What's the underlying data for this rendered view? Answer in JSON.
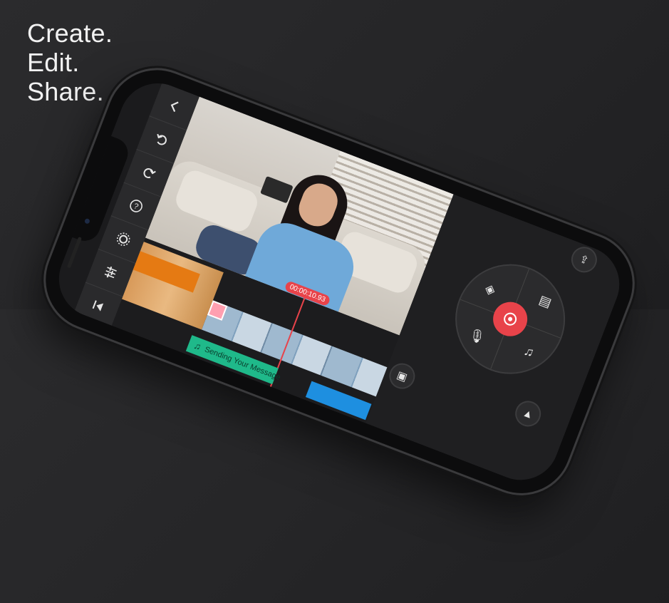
{
  "tagline": [
    "Create.",
    "Edit.",
    "Share."
  ],
  "toolbar": {
    "items": [
      {
        "name": "back-button",
        "icon": "chevron-left-icon"
      },
      {
        "name": "undo-button",
        "icon": "undo-icon"
      },
      {
        "name": "redo-button",
        "icon": "redo-icon"
      },
      {
        "name": "help-button",
        "icon": "help-icon"
      },
      {
        "name": "settings-button",
        "icon": "gear-icon"
      },
      {
        "name": "adjust-button",
        "icon": "sliders-icon"
      },
      {
        "name": "jump-start-button",
        "icon": "skip-to-start-icon"
      }
    ]
  },
  "timeline": {
    "playhead_time": "00:00:10.93",
    "audio_clip_label": "Sending Your Message"
  },
  "media_wheel": {
    "center": "camera-shutter-icon",
    "items": [
      "layers-icon",
      "media-icon",
      "music-note-icon",
      "microphone-icon"
    ]
  },
  "colors": {
    "accent": "#e8434a",
    "clip_orange": "#e57a13",
    "audio_green": "#1fb98a",
    "text_blue": "#1e8fe0"
  }
}
